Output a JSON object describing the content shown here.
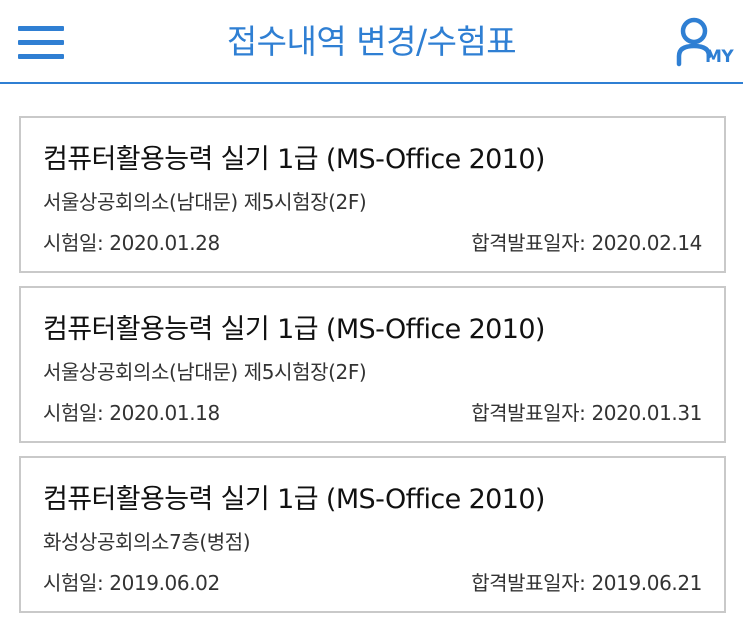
{
  "header": {
    "title": "접수내역 변경/수험표",
    "menu_icon": "hamburger-menu-icon",
    "my_icon": "user-my-icon",
    "my_label": "MY",
    "accent_color": "#2f7fd3"
  },
  "cards": [
    {
      "title": "컴퓨터활용능력 실기 1급 (MS-Office 2010)",
      "location": "서울상공회의소(남대문) 제5시험장(2F)",
      "exam_date": "시험일: 2020.01.28",
      "result_date": "합격발표일자: 2020.02.14"
    },
    {
      "title": "컴퓨터활용능력 실기 1급 (MS-Office 2010)",
      "location": "서울상공회의소(남대문) 제5시험장(2F)",
      "exam_date": "시험일: 2020.01.18",
      "result_date": "합격발표일자: 2020.01.31"
    },
    {
      "title": "컴퓨터활용능력 실기 1급 (MS-Office 2010)",
      "location": "화성상공회의소7층(병점)",
      "exam_date": "시험일: 2019.06.02",
      "result_date": "합격발표일자: 2019.06.21"
    }
  ]
}
